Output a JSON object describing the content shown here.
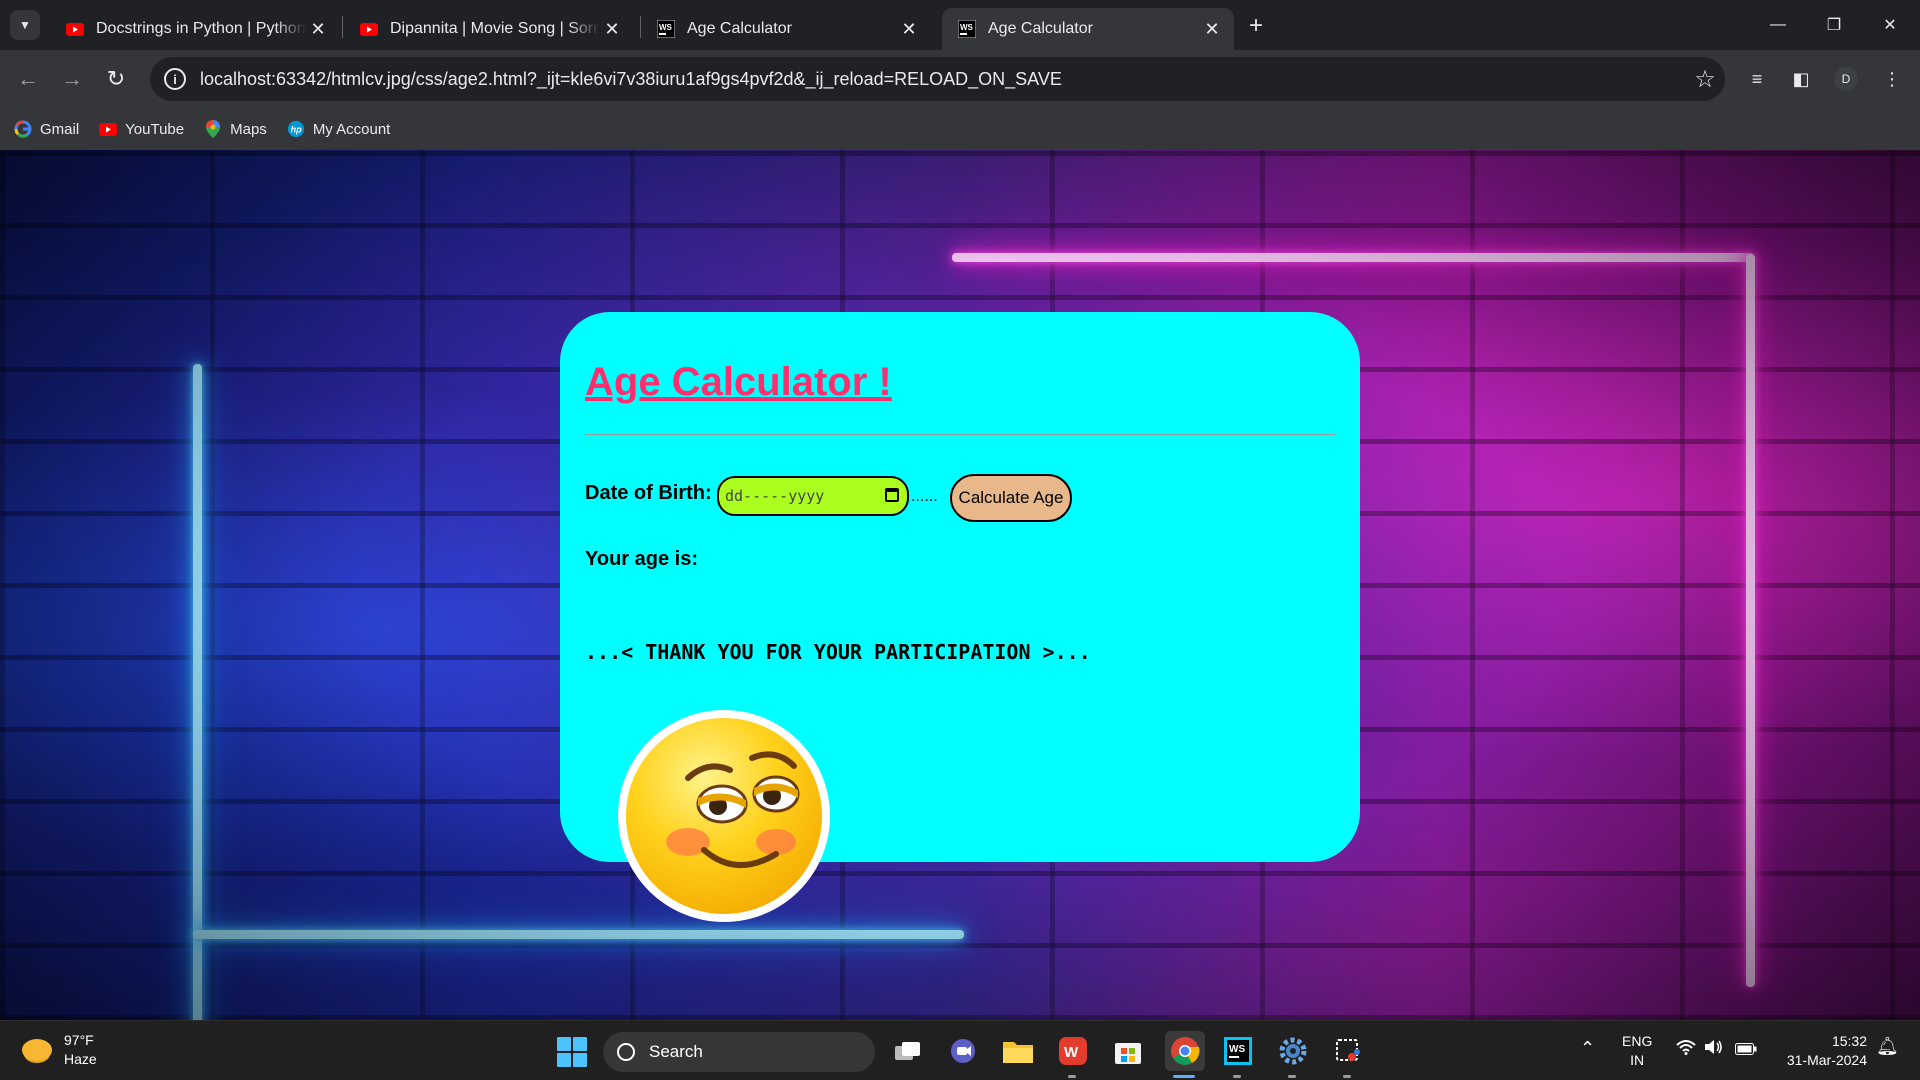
{
  "browser": {
    "tabs": [
      {
        "title": "Docstrings in Python | Python Tutorial",
        "favicon": "youtube-icon"
      },
      {
        "title": "Dipannita | Movie Song | Sorry Dipannita",
        "favicon": "youtube-icon"
      },
      {
        "title": "Age Calculator",
        "favicon": "webstorm-icon"
      },
      {
        "title": "Age Calculator",
        "favicon": "webstorm-icon",
        "active": true
      }
    ],
    "url": "localhost:63342/htmlcv.jpg/css/age2.html?_ijt=kle6vi7v38iuru1af9gs4pvf2d&_ij_reload=RELOAD_ON_SAVE",
    "profile_initial": "D",
    "bookmarks": [
      {
        "label": "Gmail",
        "icon": "google-icon"
      },
      {
        "label": "YouTube",
        "icon": "youtube-icon"
      },
      {
        "label": "Maps",
        "icon": "maps-pin-icon"
      },
      {
        "label": "My Account",
        "icon": "hp-logo-icon"
      }
    ]
  },
  "page": {
    "title": "Age Calculator !",
    "dob_label": "Date of Birth:",
    "date_placeholder": "dd-----yyyy",
    "dots": "......",
    "calculate_button": "Calculate Age",
    "age_label": "Your age is:",
    "thank_you": "...< THANK YOU FOR YOUR PARTICIPATION >...",
    "colors": {
      "card": "#00ffff",
      "title": "#ff2e6e",
      "date_input": "#aaff1e",
      "button": "#e8b88a"
    }
  },
  "taskbar": {
    "weather": {
      "temp": "97°F",
      "condition": "Haze"
    },
    "search_label": "Search",
    "language": {
      "line1": "ENG",
      "line2": "IN"
    },
    "clock": {
      "time": "15:32",
      "date": "31-Mar-2024"
    }
  }
}
